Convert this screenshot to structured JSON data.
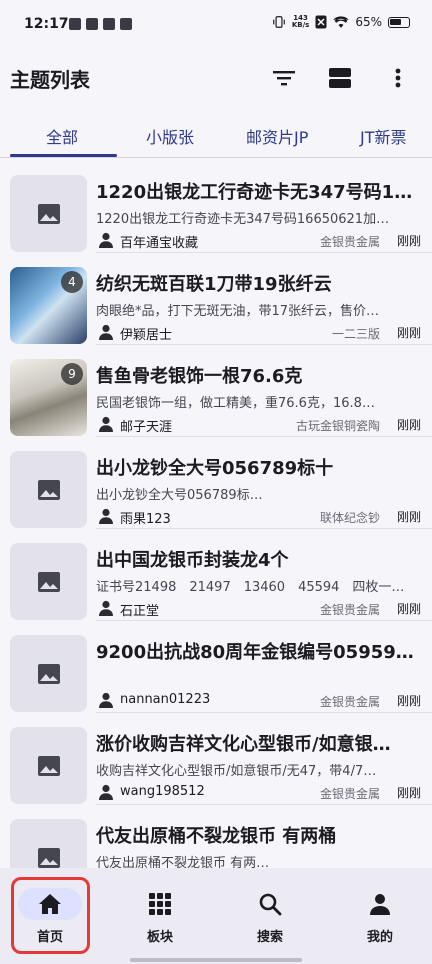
{
  "status_bar": {
    "time": "12:17",
    "net_speed_value": "143",
    "net_speed_unit": "KB/s",
    "battery": "65%"
  },
  "header": {
    "title": "主题列表",
    "icons": [
      "filter-icon",
      "view-toggle-icon",
      "more-icon"
    ]
  },
  "tabs": [
    {
      "label": "全部",
      "active": true
    },
    {
      "label": "小版张",
      "active": false
    },
    {
      "label": "邮资片JP",
      "active": false
    },
    {
      "label": "JT新票",
      "active": false
    }
  ],
  "items": [
    {
      "title": "1220出银龙工行奇迹卡无347号码1…",
      "desc": "1220出银龙工行奇迹卡无347号码16650621加…",
      "user": "百年通宝收藏",
      "category": "金银贵金属",
      "time": "刚刚",
      "thumb": "placeholder",
      "count": ""
    },
    {
      "title": "纺织无斑百联1刀带19张纤云",
      "desc": "肉眼绝*品，打下无斑无油，带17张纤云，售价…",
      "user": "伊颖居士",
      "category": "一二三版",
      "time": "刚刚",
      "thumb": "photo1",
      "count": "4"
    },
    {
      "title": "售鱼骨老银饰一根76.6克",
      "desc": "民国老银饰一组，做工精美，重76.6克，16.8…",
      "user": "邮子天涯",
      "category": "古玩金银铜瓷陶",
      "time": "刚刚",
      "thumb": "photo2",
      "count": "9"
    },
    {
      "title": "出小龙钞全大号056789标十",
      "desc": "出小龙钞全大号056789标…",
      "user": "雨果123",
      "category": "联体纪念钞",
      "time": "刚刚",
      "thumb": "placeholder",
      "count": ""
    },
    {
      "title": "出中国龙银币封装龙4个",
      "desc": "证书号21498　21497　13460　45594　四枚一…",
      "user": "石正堂",
      "category": "金银贵金属",
      "time": "刚刚",
      "thumb": "placeholder",
      "count": ""
    },
    {
      "title": "9200出抗战80周年金银编号05959…",
      "desc": "",
      "user": "nannan01223",
      "category": "金银贵金属",
      "time": "刚刚",
      "thumb": "placeholder",
      "count": ""
    },
    {
      "title": "涨价收购吉祥文化心型银币/如意银…",
      "desc": "收购吉祥文化心型银币/如意银币/无47，带4/7…",
      "user": "wang198512",
      "category": "金银贵金属",
      "time": "刚刚",
      "thumb": "placeholder",
      "count": ""
    },
    {
      "title": "代友出原桶不裂龙银币 有两桶",
      "desc": "代友出原桶不裂龙银币 有两…",
      "user": "",
      "category": "",
      "time": "",
      "thumb": "placeholder",
      "count": ""
    }
  ],
  "bottom_nav": [
    {
      "label": "首页",
      "icon": "home-icon",
      "active": true
    },
    {
      "label": "板块",
      "icon": "grid-icon",
      "active": false
    },
    {
      "label": "搜索",
      "icon": "search-icon",
      "active": false
    },
    {
      "label": "我的",
      "icon": "person-icon",
      "active": false
    }
  ],
  "colors": {
    "accent": "#2e3a8c",
    "active_nav_pill": "#dde1ff",
    "highlight": "#e53935"
  }
}
